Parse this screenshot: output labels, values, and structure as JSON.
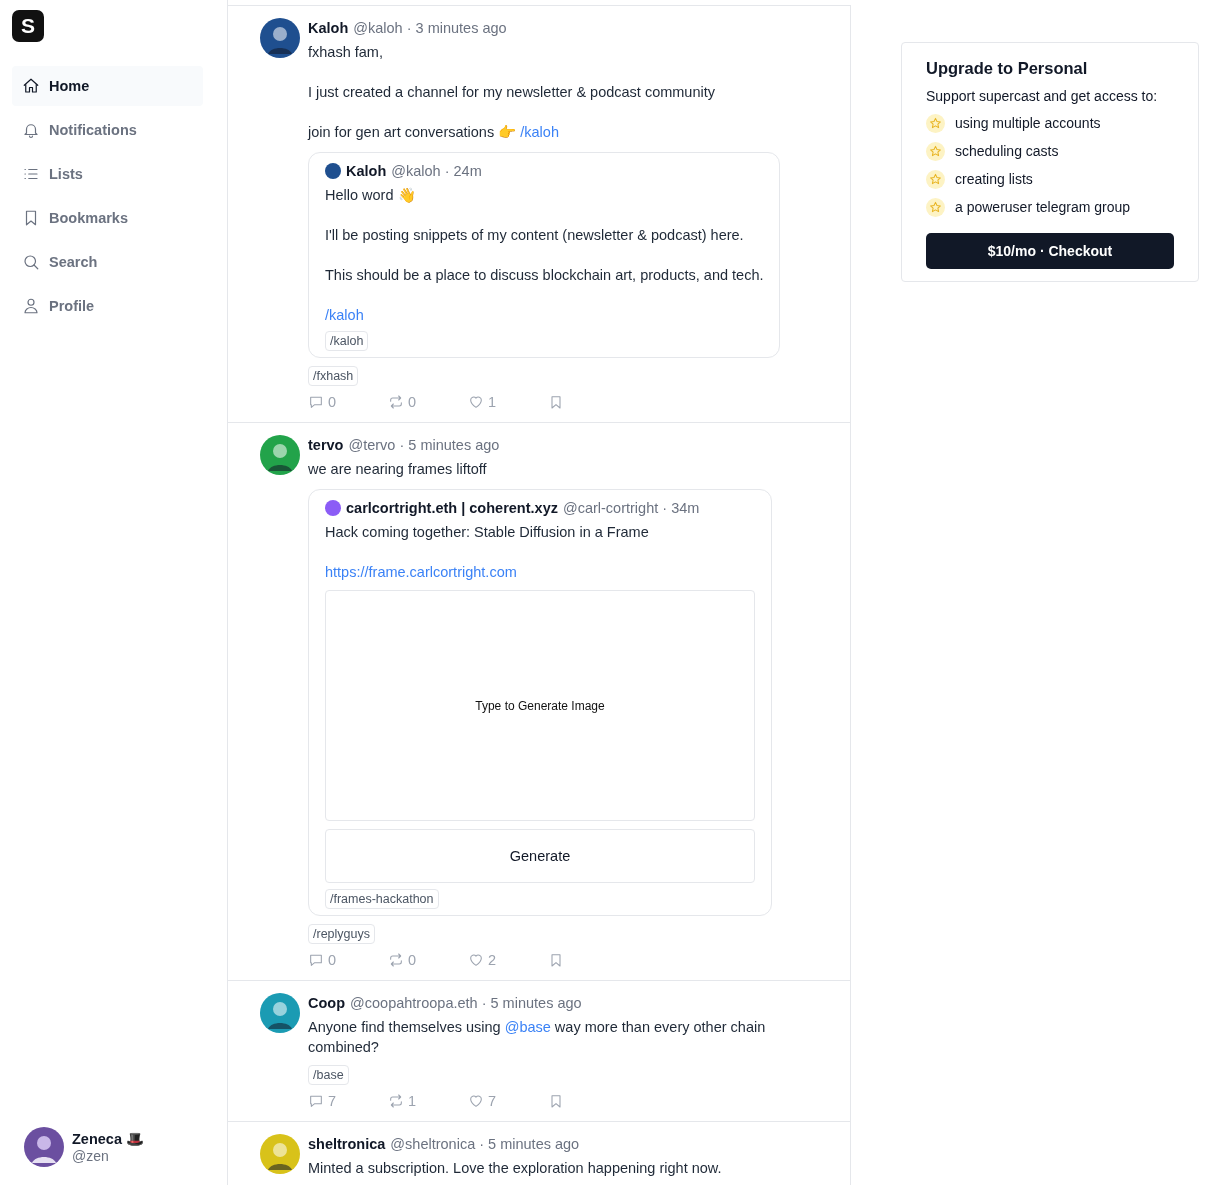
{
  "logo": "S",
  "nav": [
    {
      "label": "Home",
      "selected": true
    },
    {
      "label": "Notifications",
      "selected": false
    },
    {
      "label": "Lists",
      "selected": false
    },
    {
      "label": "Bookmarks",
      "selected": false
    },
    {
      "label": "Search",
      "selected": false
    },
    {
      "label": "Profile",
      "selected": false
    }
  ],
  "user": {
    "name": "Zeneca 🎩",
    "handle": "@zen"
  },
  "posts": [
    {
      "author": "Kaloh",
      "meta": "@kaloh · 3 minutes ago",
      "paragraphs": [
        [
          {
            "kind": "text",
            "text": "fxhash fam,"
          }
        ],
        [
          {
            "kind": "text",
            "text": "I just created a channel for my newsletter & podcast community"
          }
        ],
        [
          {
            "kind": "text",
            "text": "join for gen art conversations 👉 "
          },
          {
            "kind": "link",
            "text": "/kaloh"
          }
        ]
      ],
      "quote": {
        "author": "Kaloh",
        "meta": "@kaloh · 24m",
        "paragraphs": [
          [
            {
              "kind": "text",
              "text": "Hello word 👋"
            }
          ],
          [
            {
              "kind": "text",
              "text": "I'll be posting snippets of my content (newsletter & podcast) here."
            }
          ],
          [
            {
              "kind": "text",
              "text": "This should be a place to discuss blockchain art, products, and tech."
            }
          ],
          [
            {
              "kind": "link",
              "text": "/kaloh"
            }
          ]
        ],
        "channel": "/kaloh"
      },
      "channel": "/fxhash",
      "replies": "0",
      "recasts": "0",
      "likes": "1"
    },
    {
      "author": "tervo",
      "meta": "@tervo · 5 minutes ago",
      "paragraphs": [
        [
          {
            "kind": "text",
            "text": "we are nearing frames liftoff"
          }
        ]
      ],
      "quote": {
        "author": "carlcortright.eth | coherent.xyz",
        "meta": "@carl-cortright · 34m",
        "paragraphs": [
          [
            {
              "kind": "text",
              "text": "Hack coming together: Stable Diffusion in a Frame"
            }
          ],
          [
            {
              "kind": "link",
              "text": "https://frame.carlcortright.com"
            }
          ]
        ],
        "frame": {
          "image_text": "Type to Generate Image",
          "button": "Generate"
        },
        "channel": "/frames-hackathon"
      },
      "channel": "/replyguys",
      "replies": "0",
      "recasts": "0",
      "likes": "2"
    },
    {
      "author": "Coop",
      "meta": "@coopahtroopa.eth · 5 minutes ago",
      "paragraphs": [
        [
          {
            "kind": "text",
            "text": "Anyone find themselves using "
          },
          {
            "kind": "link",
            "text": "@base"
          },
          {
            "kind": "text",
            "text": " way more than every other chain combined?"
          }
        ]
      ],
      "channel": "/base",
      "replies": "7",
      "recasts": "1",
      "likes": "7"
    },
    {
      "author": "sheltronica",
      "meta": "@sheltronica · 5 minutes ago",
      "paragraphs": [
        [
          {
            "kind": "text",
            "text": "Minted a subscription. Love the exploration happening right now."
          }
        ]
      ]
    }
  ],
  "upgrade": {
    "title": "Upgrade to Personal",
    "subtitle": "Support supercast and get access to:",
    "features": [
      "using multiple accounts",
      "scheduling casts",
      "creating lists",
      "a poweruser telegram group"
    ],
    "button": "$10/mo · Checkout"
  }
}
